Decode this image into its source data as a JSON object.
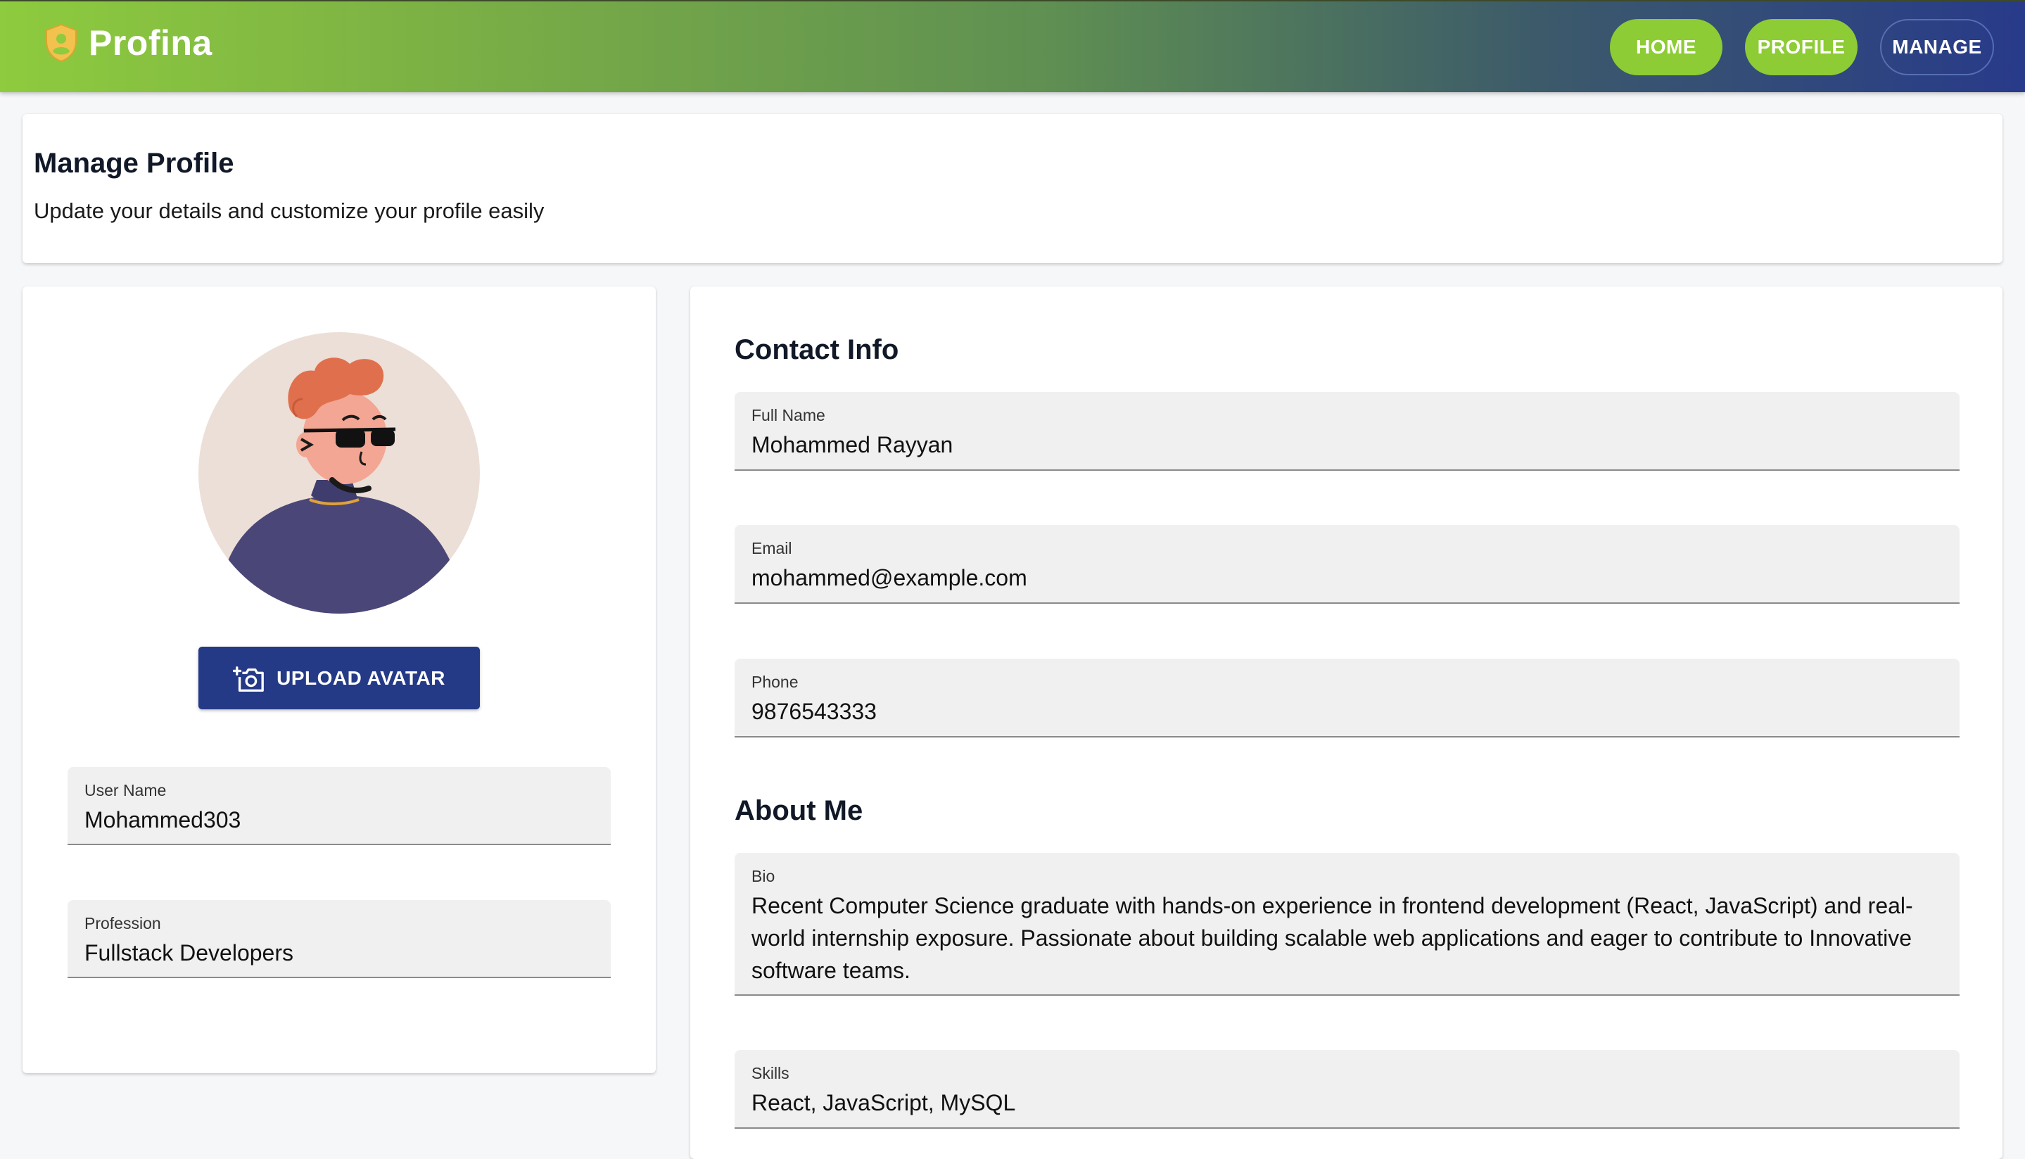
{
  "header": {
    "brand": "Profina",
    "nav": {
      "home": "HOME",
      "profile": "PROFILE",
      "manage": "MANAGE"
    }
  },
  "banner": {
    "title": "Manage Profile",
    "subtitle": "Update your details and customize your profile easily"
  },
  "left_panel": {
    "upload_button": "UPLOAD AVATAR",
    "username": {
      "label": "User Name",
      "value": "Mohammed303"
    },
    "profession": {
      "label": "Profession",
      "value": "Fullstack Developers"
    }
  },
  "contact": {
    "title": "Contact Info",
    "full_name": {
      "label": "Full Name",
      "value": "Mohammed Rayyan"
    },
    "email": {
      "label": "Email",
      "value": "mohammed@example.com"
    },
    "phone": {
      "label": "Phone",
      "value": "9876543333"
    }
  },
  "about": {
    "title": "About Me",
    "bio": {
      "label": "Bio",
      "value": "Recent Computer Science graduate with hands-on experience in frontend development (React, JavaScript) and real-world internship exposure. Passionate about building scalable web applications and eager to contribute to Innovative software teams."
    },
    "skills": {
      "label": "Skills",
      "value": "React, JavaScript, MySQL"
    }
  },
  "colors": {
    "accent_green": "#8dcc35",
    "primary_navy": "#243a87",
    "field_bg": "#f0f0f0"
  },
  "icons": {
    "brand": "shield-user-icon",
    "upload": "add-camera-icon"
  }
}
